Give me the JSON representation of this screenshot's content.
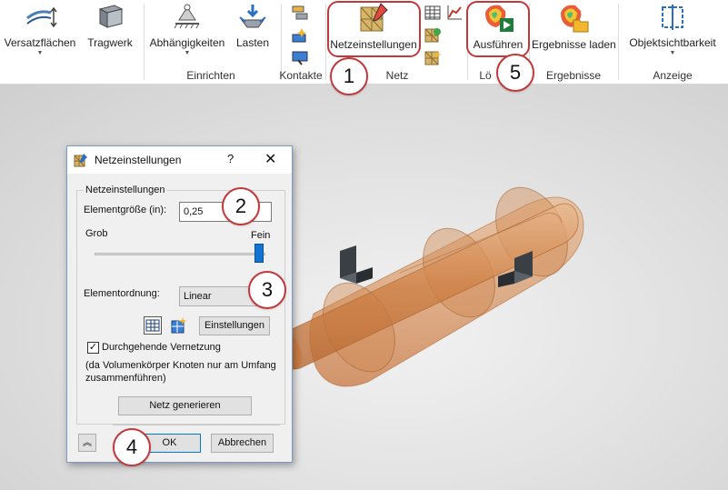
{
  "ribbon": {
    "buttons": {
      "versatz": "Versatzflächen",
      "tragwerk": "Tragwerk",
      "abhaengigkeiten": "Abhängigkeiten",
      "lasten": "Lasten",
      "netzeinstellungen": "Netzeinstellungen",
      "ausfuehren": "Ausführen",
      "ergebnisse_laden": "Ergebnisse laden",
      "objektsichtbarkeit": "Objektsichtbarkeit"
    },
    "groups": {
      "einrichten": "Einrichten",
      "kontakte": "Kontakte",
      "netz": "Netz",
      "loesen": "Lö",
      "ergebnisse": "Ergebnisse",
      "anzeige": "Anzeige"
    }
  },
  "dialog": {
    "title": "Netzeinstellungen",
    "help": "?",
    "close": "✕",
    "group_label": "Netzeinstellungen",
    "element_size_label": "Elementgröße (in):",
    "element_size_value": "0,25",
    "coarse_label": "Grob",
    "fine_label": "Fein",
    "slider_level": 1.0,
    "element_order_label": "Elementordnung:",
    "element_order_value": "Linear",
    "settings_button": "Einstellungen",
    "continuous_mesh_label": "Durchgehende Vernetzung",
    "continuous_mesh_checked": true,
    "note": "(da Volumenkörper Knoten nur am Umfang zusammenführen)",
    "generate_button": "Netz generieren",
    "ok_button": "OK",
    "cancel_button": "Abbrechen"
  },
  "callouts": {
    "c1": "1",
    "c2": "2",
    "c3": "3",
    "c4": "4",
    "c5": "5"
  },
  "colors": {
    "accent_red": "#c0393b",
    "model_orange": "#d9894f",
    "slider_blue": "#1573d1"
  }
}
